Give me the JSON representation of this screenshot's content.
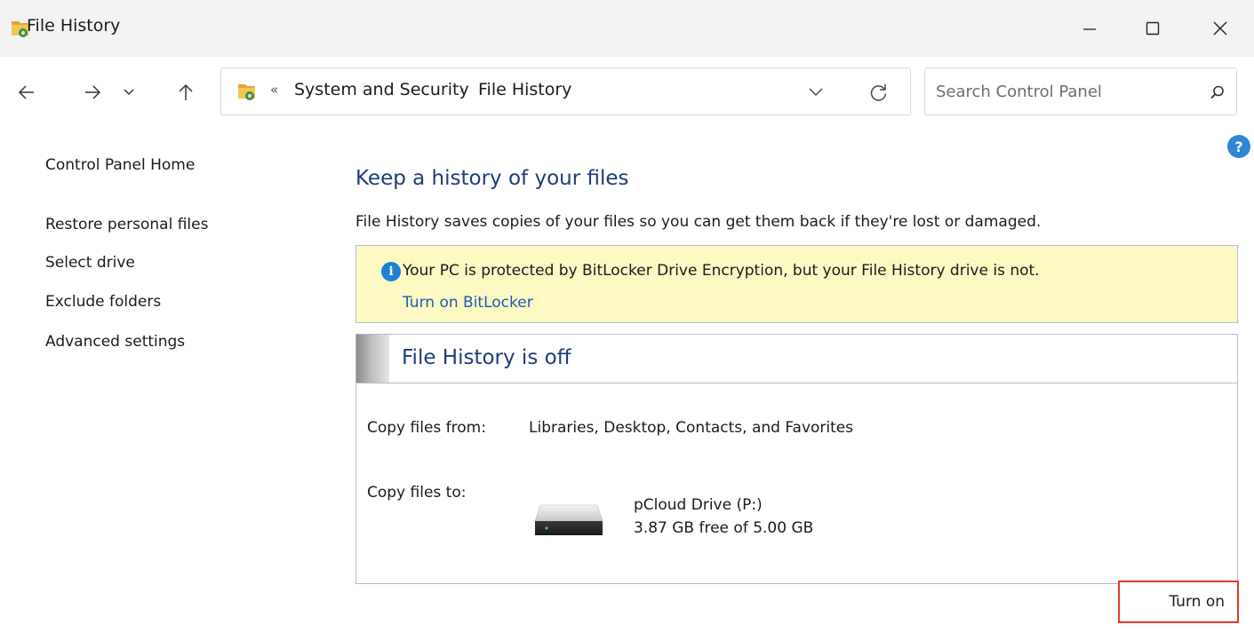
{
  "window": {
    "title": "File History",
    "icon": "file-history-folder-icon",
    "controls": [
      "minimize-icon",
      "maximize-icon",
      "close-icon"
    ]
  },
  "navbar": {
    "back_icon": "arrow-left-icon",
    "forward_icon": "arrow-right-icon",
    "recent_icon": "chevron-down-icon",
    "up_icon": "arrow-up-icon",
    "address": {
      "overflow": "«",
      "crumbs": [
        "System and Security",
        "File History"
      ],
      "separator": "›",
      "dropdown_icon": "chevron-down-icon",
      "refresh_icon": "refresh-icon"
    },
    "search": {
      "placeholder": "Search Control Panel",
      "value": "",
      "icon": "search-icon"
    }
  },
  "help": {
    "label": "?"
  },
  "left_nav": {
    "home": "Control Panel Home",
    "links": [
      "Restore personal files",
      "Select drive",
      "Exclude folders",
      "Advanced settings"
    ]
  },
  "main": {
    "heading": "Keep a history of your files",
    "description": "File History saves copies of your files so you can get them back if they're lost or damaged.",
    "warning": {
      "text": "Your PC is protected by BitLocker Drive Encryption, but your File History drive is not.",
      "link": "Turn on BitLocker",
      "color": "#fcf9c3"
    },
    "status": {
      "title": "File History is off",
      "copy_from_label": "Copy files from:",
      "copy_from_value": "Libraries, Desktop, Contacts, and Favorites",
      "copy_to_label": "Copy files to:",
      "drive_name": "pCloud Drive (P:)",
      "drive_free": "3.87 GB free of 5.00 GB",
      "drive_icon": "hard-drive-icon"
    },
    "turn_on_label": "Turn on",
    "highlight_color": "#e03a2f"
  }
}
